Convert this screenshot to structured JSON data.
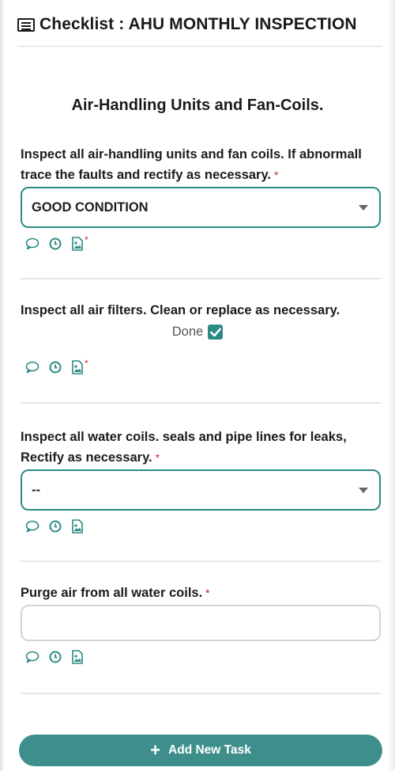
{
  "header": {
    "title": "Checklist : AHU MONTHLY INSPECTION",
    "icon": "list-alt-icon"
  },
  "section": {
    "title": "Air-Handling Units and Fan-Coils."
  },
  "tasks": [
    {
      "line1": "Inspect all air-handling units and fan coils. If abnormall",
      "line2": "trace the faults and rectify as necessary.",
      "required_mark": "*",
      "input_type": "select",
      "value": "GOOD CONDITION",
      "icons": [
        "comment-icon",
        "clock-icon",
        "image-icon"
      ],
      "image_required_mark": "*"
    },
    {
      "line1": "Inspect all air filters. Clean or replace as necessary.",
      "input_type": "checkbox",
      "checkbox_label": "Done",
      "checked": true,
      "icons": [
        "comment-icon",
        "clock-icon",
        "image-icon"
      ],
      "image_required_mark": "*"
    },
    {
      "line1": "Inspect all water coils. seals and pipe lines for leaks,",
      "line2": "Rectify as necessary.",
      "required_mark": "*",
      "input_type": "select",
      "value": "--",
      "icons": [
        "comment-icon",
        "clock-icon",
        "image-icon"
      ]
    },
    {
      "line1": "Purge air from all water coils.",
      "required_mark": "*",
      "input_type": "text",
      "value": "",
      "icons": [
        "comment-icon",
        "clock-icon",
        "image-icon"
      ]
    }
  ],
  "footer": {
    "add_button_label": "Add New Task",
    "add_icon": "plus-icon"
  },
  "colors": {
    "accent": "#2b8a84",
    "button": "#3e8f8c",
    "required": "#c62828"
  }
}
